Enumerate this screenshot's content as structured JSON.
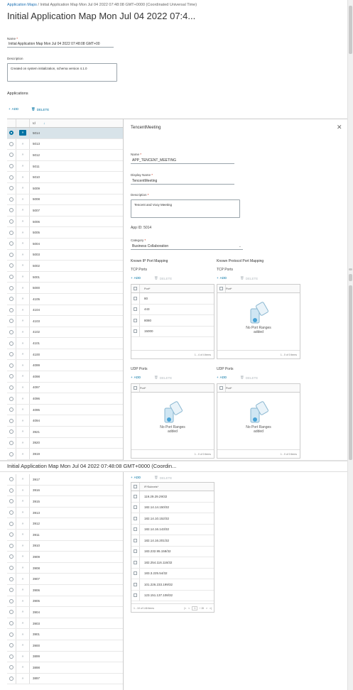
{
  "breadcrumb": {
    "parent": "Application Maps",
    "current": "Initial Application Map Mon Jul 04 2022 07:48:08 GMT+0000 (Coordinated Universal Time)"
  },
  "page_title": "Initial Application Map Mon Jul 04 2022 07:4...",
  "name_field": {
    "label": "Name",
    "value": "Initial Application Map Mon Jul 04 2022 07:48:08 GMT+00"
  },
  "description_field": {
    "label": "Description",
    "value": "Created on system initialization, schema version 4.1.0"
  },
  "applications": {
    "title": "Applications",
    "add_label": "ADD",
    "delete_label": "DELETE",
    "column_id": "Id",
    "rows_top": [
      "5014",
      "5013",
      "5012",
      "5011",
      "5010",
      "5009",
      "5008",
      "5007",
      "5006",
      "5005",
      "5004",
      "5003",
      "5002",
      "5001",
      "5000",
      "4105",
      "4104",
      "4103",
      "4102",
      "4101",
      "4100",
      "4099",
      "4098",
      "4097",
      "4096",
      "4095",
      "4094",
      "3921",
      "3920",
      "3919"
    ],
    "rows_bottom": [
      "3917",
      "3916",
      "3915",
      "3913",
      "3912",
      "3911",
      "3910",
      "3909",
      "3908",
      "3907",
      "3906",
      "3905",
      "3904",
      "3903",
      "3901",
      "3900",
      "3899",
      "3898",
      "3897"
    ]
  },
  "detail": {
    "title": "TencentMeeting",
    "name_label": "Name",
    "name_value": "APP_TENCENT_MEETING",
    "display_name_label": "Display Name",
    "display_name_value": "TencentMeeting",
    "description_label": "Description",
    "description_value": "Tencent and Vooy Meeting",
    "app_id_text": "App ID: 5014",
    "category_label": "Category",
    "category_value": "Business Collaboration",
    "known_ip_title": "Known IP Port Mapping",
    "known_protocol_title": "Known Protocol Port Mapping",
    "tcp_label": "TCP Ports",
    "udp_label": "UDP Ports",
    "add_label": "ADD",
    "delete_label": "DELETE",
    "port_col": "Port*",
    "ip_tcp_ports": [
      "80",
      "443",
      "8080",
      "15000"
    ],
    "ip_tcp_footer": "1 - 4 of 4 items",
    "empty_text_1": "No Port Ranges",
    "empty_text_2": "added",
    "empty_footer": "1 - 0 of 0 items"
  },
  "second_title": "Initial Application Map Mon Jul 04 2022 07:48:08 GMT+0000 (Coordin...",
  "subnets": {
    "add_label": "ADD",
    "delete_label": "DELETE",
    "column": "IP/Subnets*",
    "rows": [
      "119.29.29.29/32",
      "182.14.14.150/32",
      "182.14.10.152/32",
      "182.14.16.143/32",
      "182.14.16.201/32",
      "183.232.95.158/32",
      "182.254.116.116/32",
      "183.3.225.54/32",
      "101.226.233.199/32",
      "123.151.137.108/32"
    ],
    "footer_count": "1 - 10 of 146 items",
    "page": "1",
    "pages": "/ 15"
  }
}
